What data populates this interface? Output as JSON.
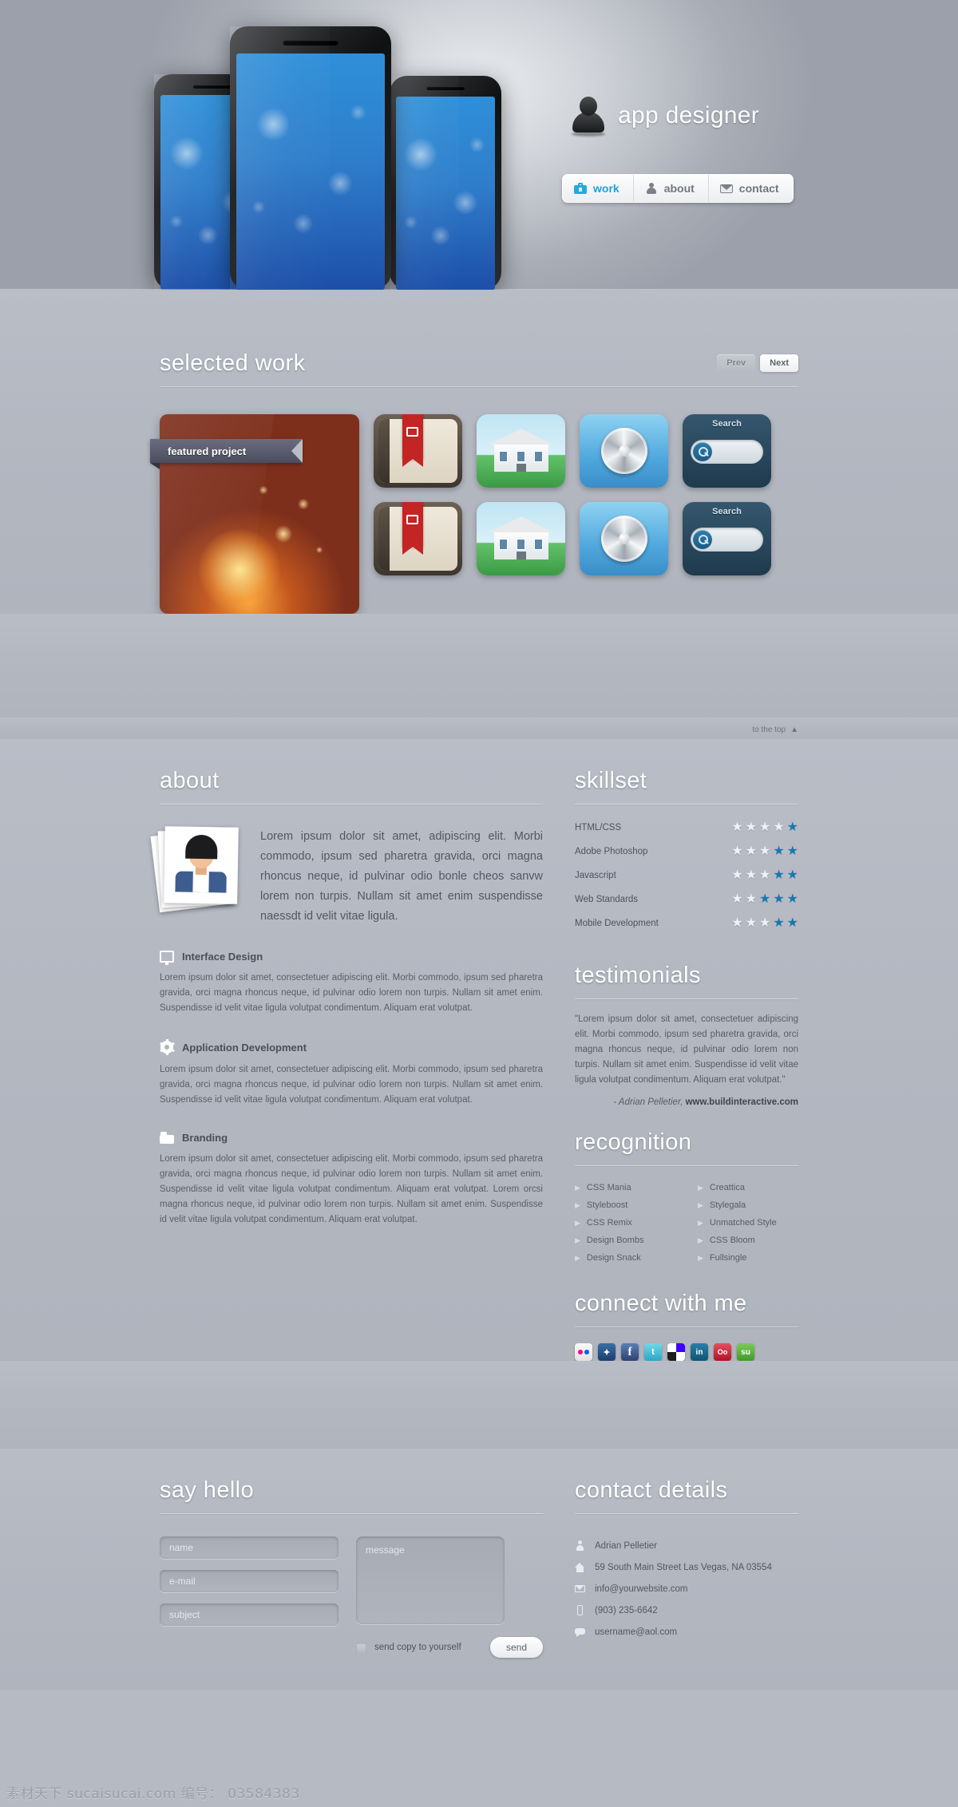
{
  "brand": {
    "title": "app designer",
    "avatar_icon": "user-silhouette-icon"
  },
  "nav": [
    {
      "label": "work",
      "icon": "briefcase-icon",
      "active": true
    },
    {
      "label": "about",
      "icon": "person-icon",
      "active": false
    },
    {
      "label": "contact",
      "icon": "envelope-icon",
      "active": false
    }
  ],
  "work": {
    "title": "selected work",
    "prev_label": "Prev",
    "next_label": "Next",
    "featured_badge": "featured project",
    "search_tile_label": "Search"
  },
  "to_the_top": "to the top",
  "about": {
    "title": "about",
    "intro": "Lorem ipsum dolor sit amet, adipiscing elit. Morbi commodo, ipsum sed pharetra gravida, orci magna rhoncus neque, id pulvinar odio bonle cheos sanvw lorem non turpis. Nullam sit amet enim suspendisse naessdt id velit vitae ligula.",
    "services": [
      {
        "icon": "monitor-icon",
        "title": "Interface Design",
        "body": "Lorem ipsum dolor sit amet, consectetuer adipiscing elit. Morbi commodo, ipsum sed pharetra gravida, orci magna rhoncus neque, id pulvinar odio lorem non turpis. Nullam sit amet enim. Suspendisse id velit vitae ligula volutpat condimentum. Aliquam erat volutpat."
      },
      {
        "icon": "gear-icon",
        "title": "Application Development",
        "body": "Lorem ipsum dolor sit amet, consectetuer adipiscing elit. Morbi commodo, ipsum sed pharetra gravida, orci magna rhoncus neque, id pulvinar odio lorem non turpis. Nullam sit amet enim. Suspendisse id velit vitae ligula volutpat condimentum. Aliquam erat volutpat."
      },
      {
        "icon": "tag-icon",
        "title": "Branding",
        "body": "Lorem ipsum dolor sit amet, consectetuer adipiscing elit. Morbi commodo, ipsum sed pharetra gravida, orci magna rhoncus neque, id pulvinar odio lorem non turpis. Nullam sit amet enim. Suspendisse id velit vitae ligula volutpat condimentum. Aliquam erat volutpat. Lorem orcsi magna rhoncus neque, id pulvinar odio lorem non turpis. Nullam sit amet enim. Suspendisse id velit vitae ligula volutpat condimentum. Aliquam erat volutpat."
      }
    ]
  },
  "skillset": {
    "title": "skillset",
    "max_stars": 5,
    "items": [
      {
        "name": "HTML/CSS",
        "filled": 4
      },
      {
        "name": "Adobe Photoshop",
        "filled": 3
      },
      {
        "name": "Javascript",
        "filled": 3
      },
      {
        "name": "Web Standards",
        "filled": 2
      },
      {
        "name": "Mobile Development",
        "filled": 3
      }
    ]
  },
  "testimonials": {
    "title": "testimonials",
    "quote": "\"Lorem ipsum dolor sit amet, consectetuer adipiscing elit. Morbi commodo, ipsum sed pharetra gravida, orci magna rhoncus neque, id pulvinar odio lorem non turpis. Nullam sit amet enim. Suspendisse id velit vitae ligula volutpat condimentum. Aliquam erat volutpat.\"",
    "author": "- Adrian Pelletier,",
    "site": "www.buildinteractive.com"
  },
  "recognition": {
    "title": "recognition",
    "col1": [
      "CSS Mania",
      "Styleboost",
      "CSS Remix",
      "Design Bombs",
      "Design Snack"
    ],
    "col2": [
      "Creattica",
      "Stylegala",
      "Unmatched Style",
      "CSS Bloom",
      "Fullsingle"
    ]
  },
  "connect": {
    "title": "connect with me",
    "icons": [
      "flickr-icon",
      "myspace-icon",
      "facebook-icon",
      "twitter-icon",
      "delicious-icon",
      "linkedin-icon",
      "lastfm-icon",
      "stumbleupon-icon"
    ],
    "glyphs": [
      "",
      "",
      "f",
      "",
      "",
      "in",
      "Oo",
      "su"
    ]
  },
  "contact_form": {
    "title": "say hello",
    "name_placeholder": "name",
    "email_placeholder": "e-mail",
    "subject_placeholder": "subject",
    "message_placeholder": "message",
    "copy_label": "send copy to yourself",
    "send_label": "send"
  },
  "contact_details": {
    "title": "contact details",
    "rows": [
      {
        "icon": "person-icon",
        "value": "Adrian Pelletier"
      },
      {
        "icon": "home-icon",
        "value": "59 South Main Street Las Vegas, NA 03554"
      },
      {
        "icon": "envelope-icon",
        "value": "info@yourwebsite.com"
      },
      {
        "icon": "phone-icon",
        "value": "(903) 235-6642"
      },
      {
        "icon": "chat-icon",
        "value": "username@aol.com"
      }
    ]
  },
  "watermark": "素材天下 sucaisucai.com  编号： 03584383",
  "colors": {
    "accent": "#1fa0dd",
    "star_blue": "#1878ae",
    "bg": "#b3b7c0"
  }
}
